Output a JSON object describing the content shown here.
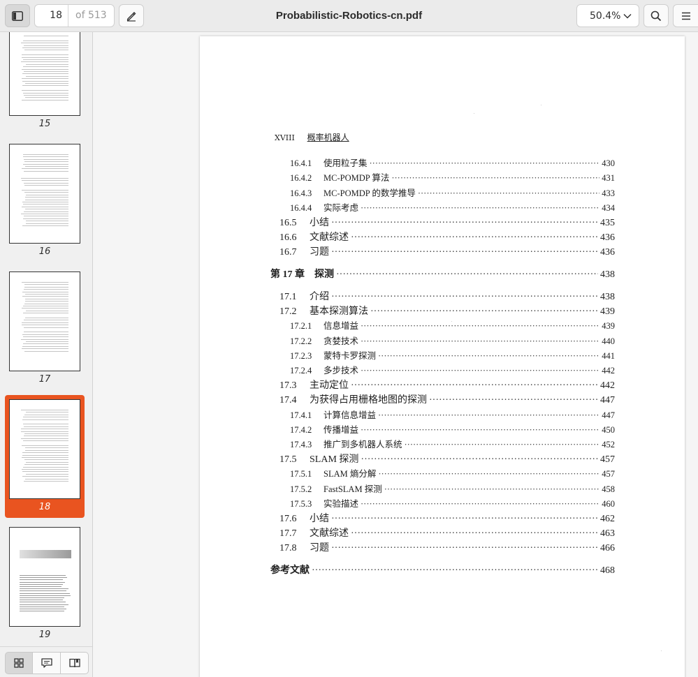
{
  "header": {
    "current_page": "18",
    "page_total": "of 513",
    "document_title": "Probabilistic-Robotics-cn.pdf",
    "zoom": "50.4%"
  },
  "icons": {
    "sidebar_toggle": "sidebar-icon",
    "annotate": "pen-icon",
    "zoom_menu": "chevron-down-icon",
    "search": "search-icon",
    "menu": "hamburger-icon",
    "thumbnails_view": "grid-icon",
    "annotations_view": "comment-icon",
    "bookmarks_view": "book-icon"
  },
  "colors": {
    "accent": "#e95420"
  },
  "sidebar": {
    "thumbnails": [
      {
        "label": "15"
      },
      {
        "label": "16"
      },
      {
        "label": "17"
      },
      {
        "label": "18",
        "selected": true
      },
      {
        "label": "19"
      }
    ]
  },
  "page": {
    "running_head_number": "XVIII",
    "running_head_title": "概率机器人",
    "toc": [
      {
        "level": 3,
        "number": "16.4.1",
        "title": "使用粒子集",
        "page": "430"
      },
      {
        "level": 3,
        "number": "16.4.2",
        "title": "MC-POMDP 算法",
        "page": "431"
      },
      {
        "level": 3,
        "number": "16.4.3",
        "title": "MC-POMDP 的数学推导",
        "page": "433"
      },
      {
        "level": 3,
        "number": "16.4.4",
        "title": "实际考虑",
        "page": "434"
      },
      {
        "level": 2,
        "number": "16.5",
        "title": "小结",
        "page": "435"
      },
      {
        "level": 2,
        "number": "16.6",
        "title": "文献综述",
        "page": "436"
      },
      {
        "level": 2,
        "number": "16.7",
        "title": "习题",
        "page": "436"
      },
      {
        "level": 1,
        "number": "第 17 章",
        "title": "探测",
        "page": "438"
      },
      {
        "level": 2,
        "number": "17.1",
        "title": "介绍",
        "page": "438"
      },
      {
        "level": 2,
        "number": "17.2",
        "title": "基本探测算法",
        "page": "439"
      },
      {
        "level": 3,
        "number": "17.2.1",
        "title": "信息增益",
        "page": "439"
      },
      {
        "level": 3,
        "number": "17.2.2",
        "title": "贪婪技术",
        "page": "440"
      },
      {
        "level": 3,
        "number": "17.2.3",
        "title": "蒙特卡罗探测",
        "page": "441"
      },
      {
        "level": 3,
        "number": "17.2.4",
        "title": "多步技术",
        "page": "442"
      },
      {
        "level": 2,
        "number": "17.3",
        "title": "主动定位",
        "page": "442"
      },
      {
        "level": 2,
        "number": "17.4",
        "title": "为获得占用栅格地图的探测",
        "page": "447"
      },
      {
        "level": 3,
        "number": "17.4.1",
        "title": "计算信息增益",
        "page": "447"
      },
      {
        "level": 3,
        "number": "17.4.2",
        "title": "传播增益",
        "page": "450"
      },
      {
        "level": 3,
        "number": "17.4.3",
        "title": "推广到多机器人系统",
        "page": "452"
      },
      {
        "level": 2,
        "number": "17.5",
        "title": "SLAM 探测",
        "page": "457"
      },
      {
        "level": 3,
        "number": "17.5.1",
        "title": "SLAM 熵分解",
        "page": "457"
      },
      {
        "level": 3,
        "number": "17.5.2",
        "title": "FastSLAM 探测",
        "page": "458"
      },
      {
        "level": 3,
        "number": "17.5.3",
        "title": "实验描述",
        "page": "460"
      },
      {
        "level": 2,
        "number": "17.6",
        "title": "小结",
        "page": "462"
      },
      {
        "level": 2,
        "number": "17.7",
        "title": "文献综述",
        "page": "463"
      },
      {
        "level": 2,
        "number": "17.8",
        "title": "习题",
        "page": "466"
      },
      {
        "level": 1,
        "number": "",
        "title": "参考文献",
        "page": "468"
      }
    ]
  }
}
